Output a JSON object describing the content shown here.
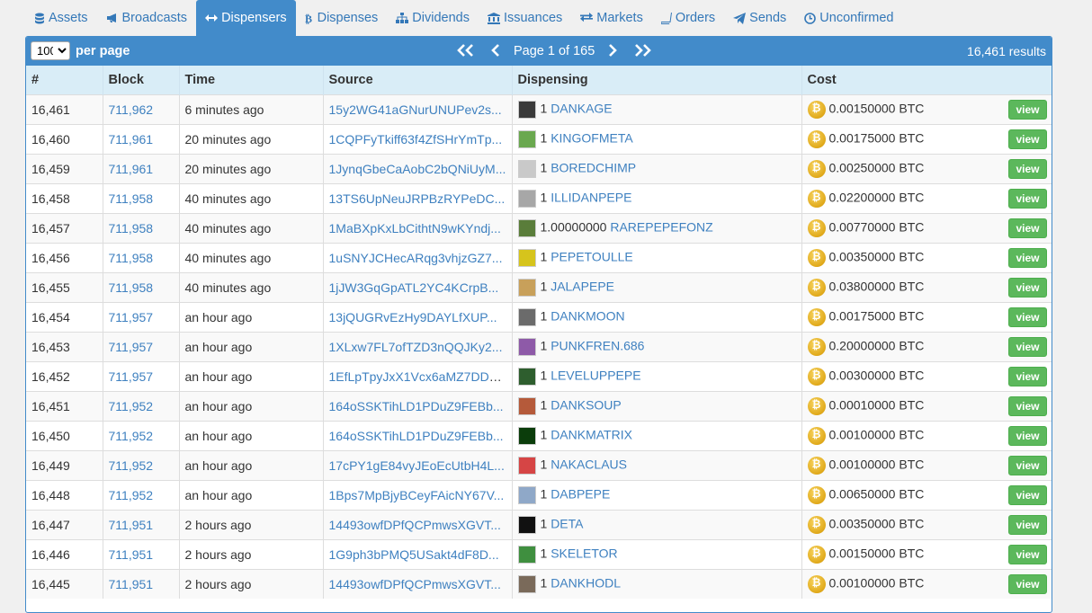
{
  "tabs": [
    {
      "label": "Assets",
      "icon": "database-icon",
      "active": false
    },
    {
      "label": "Broadcasts",
      "icon": "bullhorn-icon",
      "active": false
    },
    {
      "label": "Dispensers",
      "icon": "arrows-h-icon",
      "active": true
    },
    {
      "label": "Dispenses",
      "icon": "bitcoin-icon",
      "active": false
    },
    {
      "label": "Dividends",
      "icon": "sitemap-icon",
      "active": false
    },
    {
      "label": "Issuances",
      "icon": "bank-icon",
      "active": false
    },
    {
      "label": "Markets",
      "icon": "exchange-icon",
      "active": false
    },
    {
      "label": "Orders",
      "icon": "book-icon",
      "active": false
    },
    {
      "label": "Sends",
      "icon": "paper-plane-icon",
      "active": false
    },
    {
      "label": "Unconfirmed",
      "icon": "clock-icon",
      "active": false
    }
  ],
  "pagination": {
    "per_page_value": "100",
    "per_page_label": "per page",
    "first": "«",
    "prev": "‹",
    "page_info": "Page 1 of 165",
    "next": "›",
    "last": "»",
    "results": "16,461 results"
  },
  "columns": [
    "#",
    "Block",
    "Time",
    "Source",
    "Dispensing",
    "Cost"
  ],
  "view_label": "view",
  "rows": [
    {
      "num": "16,461",
      "block": "711,962",
      "time": "6 minutes ago",
      "source": "15y2WG41aGNurUNUPev2s...",
      "amount": "1",
      "asset": "DANKAGE",
      "cost": "0.00150000 BTC",
      "icon_color": "#3a3a3a"
    },
    {
      "num": "16,460",
      "block": "711,961",
      "time": "20 minutes ago",
      "source": "1CQPFyTkiff63f4ZfSHrYmTp...",
      "amount": "1",
      "asset": "KINGOFMETA",
      "cost": "0.00175000 BTC",
      "icon_color": "#6aa84f"
    },
    {
      "num": "16,459",
      "block": "711,961",
      "time": "20 minutes ago",
      "source": "1JynqGbeCaAobC2bQNiUyM...",
      "amount": "1",
      "asset": "BOREDCHIMP",
      "cost": "0.00250000 BTC",
      "icon_color": "#c9c9c9"
    },
    {
      "num": "16,458",
      "block": "711,958",
      "time": "40 minutes ago",
      "source": "13TS6UpNeuJRPBzRYPeDC...",
      "amount": "1",
      "asset": "ILLIDANPEPE",
      "cost": "0.02200000 BTC",
      "icon_color": "#a7a7a7"
    },
    {
      "num": "16,457",
      "block": "711,958",
      "time": "40 minutes ago",
      "source": "1MaBXpKxLbCithtN9wKYndj...",
      "amount": "1.00000000",
      "asset": "RAREPEPEFONZ",
      "cost": "0.00770000 BTC",
      "icon_color": "#5a7d3a"
    },
    {
      "num": "16,456",
      "block": "711,958",
      "time": "40 minutes ago",
      "source": "1uSNYJCHecARqg3vhjzGZ7...",
      "amount": "1",
      "asset": "PEPETOULLE",
      "cost": "0.00350000 BTC",
      "icon_color": "#d6c41c"
    },
    {
      "num": "16,455",
      "block": "711,958",
      "time": "40 minutes ago",
      "source": "1jJW3GqGpATL2YC4KCrpB...",
      "amount": "1",
      "asset": "JALAPEPE",
      "cost": "0.03800000 BTC",
      "icon_color": "#c8a05a"
    },
    {
      "num": "16,454",
      "block": "711,957",
      "time": "an hour ago",
      "source": "13jQUGRvEzHy9DAYLfXUP...",
      "amount": "1",
      "asset": "DANKMOON",
      "cost": "0.00175000 BTC",
      "icon_color": "#6b6b6b"
    },
    {
      "num": "16,453",
      "block": "711,957",
      "time": "an hour ago",
      "source": "1XLxw7FL7ofTZD3nQQJKy2...",
      "amount": "1",
      "asset": "PUNKFREN.686",
      "cost": "0.20000000 BTC",
      "icon_color": "#8e5aa8"
    },
    {
      "num": "16,452",
      "block": "711,957",
      "time": "an hour ago",
      "source": "1EfLpTpyJxX1Vcx6aMZ7DDa...",
      "amount": "1",
      "asset": "LEVELUPPEPE",
      "cost": "0.00300000 BTC",
      "icon_color": "#2e5e2e"
    },
    {
      "num": "16,451",
      "block": "711,952",
      "time": "an hour ago",
      "source": "164oSSKTihLD1PDuZ9FEBb...",
      "amount": "1",
      "asset": "DANKSOUP",
      "cost": "0.00010000 BTC",
      "icon_color": "#b55a3a"
    },
    {
      "num": "16,450",
      "block": "711,952",
      "time": "an hour ago",
      "source": "164oSSKTihLD1PDuZ9FEBb...",
      "amount": "1",
      "asset": "DANKMATRIX",
      "cost": "0.00100000 BTC",
      "icon_color": "#0b3d0b"
    },
    {
      "num": "16,449",
      "block": "711,952",
      "time": "an hour ago",
      "source": "17cPY1gE84vyJEoEcUtbH4L...",
      "amount": "1",
      "asset": "NAKACLAUS",
      "cost": "0.00100000 BTC",
      "icon_color": "#d64545"
    },
    {
      "num": "16,448",
      "block": "711,952",
      "time": "an hour ago",
      "source": "1Bps7MpBjyBCeyFAicNY67V...",
      "amount": "1",
      "asset": "DABPEPE",
      "cost": "0.00650000 BTC",
      "icon_color": "#8fa8c8"
    },
    {
      "num": "16,447",
      "block": "711,951",
      "time": "2 hours ago",
      "source": "14493owfDPfQCPmwsXGVT...",
      "amount": "1",
      "asset": "DETA",
      "cost": "0.00350000 BTC",
      "icon_color": "#111111"
    },
    {
      "num": "16,446",
      "block": "711,951",
      "time": "2 hours ago",
      "source": "1G9ph3bPMQ5USakt4dF8D...",
      "amount": "1",
      "asset": "SKELETOR",
      "cost": "0.00150000 BTC",
      "icon_color": "#3f8f3f"
    },
    {
      "num": "16,445",
      "block": "711,951",
      "time": "2 hours ago",
      "source": "14493owfDPfQCPmwsXGVT...",
      "amount": "1",
      "asset": "DANKHODL",
      "cost": "0.00100000 BTC",
      "icon_color": "#7a6a5a"
    }
  ]
}
